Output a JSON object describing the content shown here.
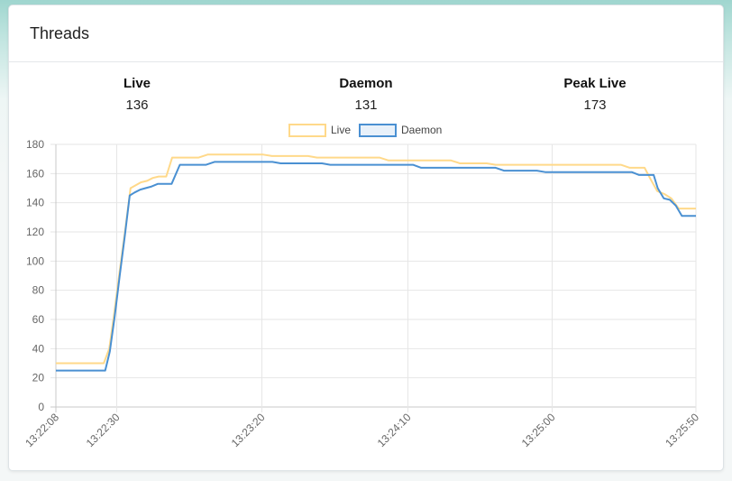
{
  "panel": {
    "title": "Threads"
  },
  "stats": [
    {
      "label": "Live",
      "value": "136"
    },
    {
      "label": "Daemon",
      "value": "131"
    },
    {
      "label": "Peak Live",
      "value": "173"
    }
  ],
  "chart_data": {
    "type": "line",
    "title": "",
    "xlabel": "",
    "ylabel": "",
    "x_tick_labels": [
      "13:22:08",
      "13:22:30",
      "13:23:20",
      "13:24:10",
      "13:25:00",
      "13:25:50"
    ],
    "x_ticks_seconds": [
      0,
      22,
      72,
      122,
      172,
      222
    ],
    "y_ticks": [
      0,
      20,
      40,
      60,
      80,
      100,
      120,
      140,
      160,
      180
    ],
    "ylim": [
      0,
      180
    ],
    "grid": true,
    "legend_position": "top",
    "series": [
      {
        "name": "Live",
        "color": "#ffd98a",
        "fill": "#ffffff",
        "points": [
          [
            0,
            30
          ],
          [
            22,
            30
          ],
          [
            24.5,
            40
          ],
          [
            26.8,
            64
          ],
          [
            29.2,
            92
          ],
          [
            31.7,
            120
          ],
          [
            34.3,
            150
          ],
          [
            36.7,
            152
          ],
          [
            39.1,
            154
          ],
          [
            41.9,
            155
          ],
          [
            44.5,
            157
          ],
          [
            47.2,
            158
          ],
          [
            50.7,
            158
          ],
          [
            53.4,
            171
          ],
          [
            57.5,
            171
          ],
          [
            61.6,
            171
          ],
          [
            65.6,
            171
          ],
          [
            69.7,
            173
          ],
          [
            74.6,
            173
          ],
          [
            78.8,
            173
          ],
          [
            82.9,
            173
          ],
          [
            87.0,
            173
          ],
          [
            91.1,
            173
          ],
          [
            95.2,
            173
          ],
          [
            99.3,
            172
          ],
          [
            103.4,
            172
          ],
          [
            107.6,
            172
          ],
          [
            111.7,
            172
          ],
          [
            115.8,
            172
          ],
          [
            119.9,
            171
          ],
          [
            124.0,
            171
          ],
          [
            128.1,
            171
          ],
          [
            132.2,
            171
          ],
          [
            136.3,
            171
          ],
          [
            140.4,
            171
          ],
          [
            144.5,
            171
          ],
          [
            148.6,
            171
          ],
          [
            152.8,
            169
          ],
          [
            156.9,
            169
          ],
          [
            161.0,
            169
          ],
          [
            165.1,
            169
          ],
          [
            169.2,
            169
          ],
          [
            173.3,
            169
          ],
          [
            177.4,
            169
          ],
          [
            181.5,
            169
          ],
          [
            185.6,
            167
          ],
          [
            189.7,
            167
          ],
          [
            193.8,
            167
          ],
          [
            197.9,
            167
          ],
          [
            202.0,
            166
          ],
          [
            206.2,
            166
          ],
          [
            210.3,
            166
          ],
          [
            214.4,
            166
          ],
          [
            218.5,
            166
          ],
          [
            222.6,
            166
          ],
          [
            226.7,
            166
          ],
          [
            230.8,
            166
          ],
          [
            234.9,
            166
          ],
          [
            239.0,
            166
          ],
          [
            243.1,
            166
          ],
          [
            247.2,
            166
          ],
          [
            251.3,
            166
          ],
          [
            255.4,
            166
          ],
          [
            259.5,
            166
          ],
          [
            263.6,
            164
          ],
          [
            267.0,
            164
          ],
          [
            270.4,
            164
          ],
          [
            273.2,
            156
          ],
          [
            276.2,
            148
          ],
          [
            279.5,
            146
          ],
          [
            282.7,
            143
          ],
          [
            286.1,
            136
          ],
          [
            289.8,
            136
          ],
          [
            294.0,
            136
          ]
        ]
      },
      {
        "name": "Daemon",
        "color": "#4a90d2",
        "fill": "#e8f1fa",
        "points": [
          [
            0,
            25
          ],
          [
            22,
            25
          ],
          [
            24.5,
            25
          ],
          [
            26.8,
            38
          ],
          [
            29.2,
            62
          ],
          [
            31.7,
            90
          ],
          [
            34.3,
            118
          ],
          [
            36.7,
            145
          ],
          [
            39.1,
            147
          ],
          [
            41.9,
            149
          ],
          [
            44.5,
            150
          ],
          [
            47.2,
            151
          ],
          [
            50.7,
            153
          ],
          [
            53.4,
            153
          ],
          [
            57.5,
            153
          ],
          [
            61.6,
            166
          ],
          [
            65.6,
            166
          ],
          [
            69.7,
            166
          ],
          [
            74.6,
            166
          ],
          [
            78.8,
            168
          ],
          [
            82.9,
            168
          ],
          [
            87.0,
            168
          ],
          [
            91.1,
            168
          ],
          [
            95.2,
            168
          ],
          [
            99.3,
            168
          ],
          [
            103.4,
            168
          ],
          [
            107.6,
            168
          ],
          [
            111.7,
            167
          ],
          [
            115.8,
            167
          ],
          [
            119.9,
            167
          ],
          [
            124.0,
            167
          ],
          [
            128.1,
            167
          ],
          [
            132.2,
            167
          ],
          [
            136.3,
            166
          ],
          [
            140.4,
            166
          ],
          [
            144.5,
            166
          ],
          [
            148.6,
            166
          ],
          [
            152.8,
            166
          ],
          [
            156.9,
            166
          ],
          [
            161.0,
            166
          ],
          [
            165.1,
            166
          ],
          [
            169.2,
            166
          ],
          [
            173.3,
            166
          ],
          [
            177.4,
            166
          ],
          [
            181.5,
            164
          ],
          [
            185.6,
            164
          ],
          [
            189.7,
            164
          ],
          [
            193.8,
            164
          ],
          [
            197.9,
            164
          ],
          [
            202.0,
            164
          ],
          [
            206.2,
            164
          ],
          [
            210.3,
            164
          ],
          [
            214.4,
            164
          ],
          [
            218.5,
            164
          ],
          [
            222.6,
            162
          ],
          [
            226.7,
            162
          ],
          [
            230.8,
            162
          ],
          [
            234.9,
            162
          ],
          [
            239.0,
            162
          ],
          [
            243.1,
            161
          ],
          [
            247.2,
            161
          ],
          [
            251.3,
            161
          ],
          [
            255.4,
            161
          ],
          [
            259.5,
            161
          ],
          [
            263.6,
            161
          ],
          [
            267.0,
            161
          ],
          [
            270.4,
            161
          ],
          [
            273.2,
            161
          ],
          [
            276.2,
            161
          ],
          [
            279.5,
            161
          ],
          [
            282.7,
            161
          ],
          [
            286.1,
            161
          ],
          [
            289.8,
            159
          ],
          [
            294.0,
            159
          ],
          [
            297.0,
            159
          ],
          [
            299.0,
            150
          ],
          [
            302.0,
            143
          ],
          [
            305.0,
            142
          ],
          [
            308.0,
            138
          ],
          [
            311.0,
            131
          ],
          [
            314.0,
            131
          ],
          [
            318.0,
            131
          ]
        ]
      }
    ]
  }
}
